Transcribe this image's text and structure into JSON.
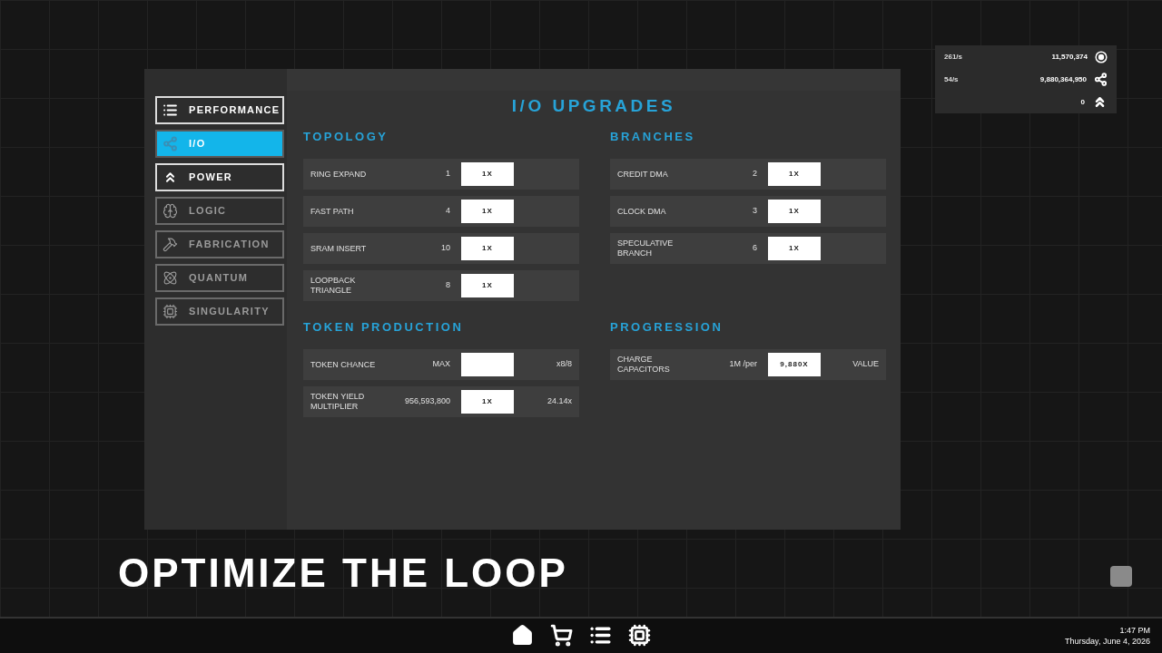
{
  "sidebar": {
    "items": [
      {
        "label": "PERFORMANCE",
        "selected": false,
        "disabled": false
      },
      {
        "label": "I/O",
        "selected": true,
        "disabled": false
      },
      {
        "label": "POWER",
        "selected": false,
        "disabled": false
      },
      {
        "label": "LOGIC",
        "selected": false,
        "disabled": true
      },
      {
        "label": "FABRICATION",
        "selected": false,
        "disabled": true
      },
      {
        "label": "QUANTUM",
        "selected": false,
        "disabled": true
      },
      {
        "label": "SINGULARITY",
        "selected": false,
        "disabled": true
      }
    ]
  },
  "panel": {
    "title": "I/O UPGRADES",
    "sections": [
      {
        "title": "TOPOLOGY",
        "rows": [
          {
            "label": "RING EXPAND",
            "value": "1",
            "button": "1X"
          },
          {
            "label": "FAST PATH",
            "value": "4",
            "button": "1X"
          },
          {
            "label": "SRAM INSERT",
            "value": "10",
            "button": "1X"
          },
          {
            "label": "LOOPBACK TRIANGLE",
            "value": "8",
            "button": "1X"
          }
        ]
      },
      {
        "title": "BRANCHES",
        "rows": [
          {
            "label": "CREDIT DMA",
            "value": "2",
            "button": "1X"
          },
          {
            "label": "CLOCK DMA",
            "value": "3",
            "button": "1X"
          },
          {
            "label": "SPECULATIVE BRANCH",
            "value": "6",
            "button": "1X"
          }
        ]
      },
      {
        "title": "TOKEN PRODUCTION",
        "rows": [
          {
            "label": "TOKEN CHANCE",
            "value": "MAX",
            "extra": "x8/8"
          },
          {
            "label": "TOKEN YIELD MULTIPLIER",
            "value": "956,593,800",
            "button": "1X",
            "extra": "24.14x"
          }
        ]
      },
      {
        "title": "PROGRESSION",
        "rows": [
          {
            "label": "CHARGE CAPACITORS",
            "value": "1M /per",
            "button": "9,880X",
            "extra": "VALUE"
          }
        ]
      }
    ]
  },
  "stats": [
    {
      "rate": "261/s",
      "amount": "11,570,374"
    },
    {
      "rate": "54/s",
      "amount": "9,880,364,950"
    },
    {
      "amount": "0"
    }
  ],
  "headline": "OPTIMIZE THE LOOP",
  "clock": {
    "time": "1:47 PM",
    "date": "Thursday, June 4, 2026"
  }
}
